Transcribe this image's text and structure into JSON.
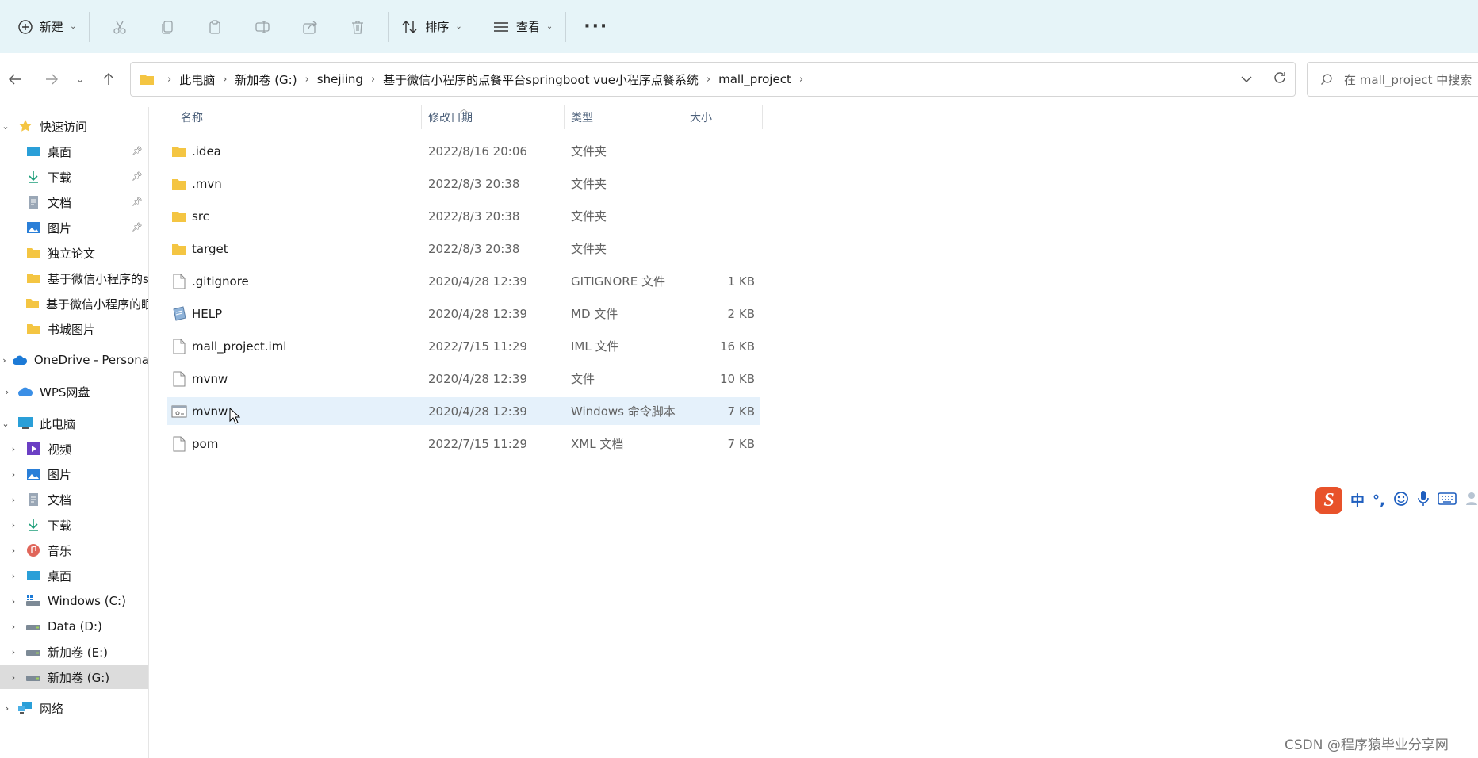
{
  "toolbar": {
    "new_label": "新建",
    "sort_label": "排序",
    "view_label": "查看"
  },
  "breadcrumb": [
    "此电脑",
    "新加卷 (G:)",
    "shejiing",
    "基于微信小程序的点餐平台springboot vue小程序点餐系统",
    "mall_project"
  ],
  "search": {
    "placeholder": "在 mall_project 中搜索"
  },
  "nav": {
    "quick_access": "快速访问",
    "quick_items": [
      {
        "label": "桌面",
        "pinned": true
      },
      {
        "label": "下载",
        "pinned": true
      },
      {
        "label": "文档",
        "pinned": true
      },
      {
        "label": "图片",
        "pinned": true
      },
      {
        "label": "独立论文"
      },
      {
        "label": "基于微信小程序的s"
      },
      {
        "label": "基于微信小程序的眼"
      },
      {
        "label": "书城图片"
      }
    ],
    "onedrive": "OneDrive - Persona",
    "wps": "WPS网盘",
    "this_pc": "此电脑",
    "pc_items": [
      "视频",
      "图片",
      "文档",
      "下载",
      "音乐",
      "桌面",
      "Windows (C:)",
      "Data (D:)",
      "新加卷 (E:)",
      "新加卷 (G:)"
    ],
    "network": "网络"
  },
  "columns": {
    "name": "名称",
    "date": "修改日期",
    "type": "类型",
    "size": "大小"
  },
  "files": [
    {
      "name": ".idea",
      "date": "2022/8/16 20:06",
      "type": "文件夹",
      "size": "",
      "icon": "folder"
    },
    {
      "name": ".mvn",
      "date": "2022/8/3 20:38",
      "type": "文件夹",
      "size": "",
      "icon": "folder"
    },
    {
      "name": "src",
      "date": "2022/8/3 20:38",
      "type": "文件夹",
      "size": "",
      "icon": "folder"
    },
    {
      "name": "target",
      "date": "2022/8/3 20:38",
      "type": "文件夹",
      "size": "",
      "icon": "folder"
    },
    {
      "name": ".gitignore",
      "date": "2020/4/28 12:39",
      "type": "GITIGNORE 文件",
      "size": "1 KB",
      "icon": "file"
    },
    {
      "name": "HELP",
      "date": "2020/4/28 12:39",
      "type": "MD 文件",
      "size": "2 KB",
      "icon": "md"
    },
    {
      "name": "mall_project.iml",
      "date": "2022/7/15 11:29",
      "type": "IML 文件",
      "size": "16 KB",
      "icon": "file"
    },
    {
      "name": "mvnw",
      "date": "2020/4/28 12:39",
      "type": "文件",
      "size": "10 KB",
      "icon": "file"
    },
    {
      "name": "mvnw",
      "date": "2020/4/28 12:39",
      "type": "Windows 命令脚本",
      "size": "7 KB",
      "icon": "cmd",
      "selected": true
    },
    {
      "name": "pom",
      "date": "2022/7/15 11:29",
      "type": "XML 文档",
      "size": "7 KB",
      "icon": "file"
    }
  ],
  "ime": {
    "lang": "中",
    "punct": "°,"
  },
  "watermark": "CSDN @程序猿毕业分享网",
  "colors": {
    "folder": "#f4c542",
    "selected_row": "#e5f1fb",
    "cmdbar": "#e6f4f8"
  }
}
